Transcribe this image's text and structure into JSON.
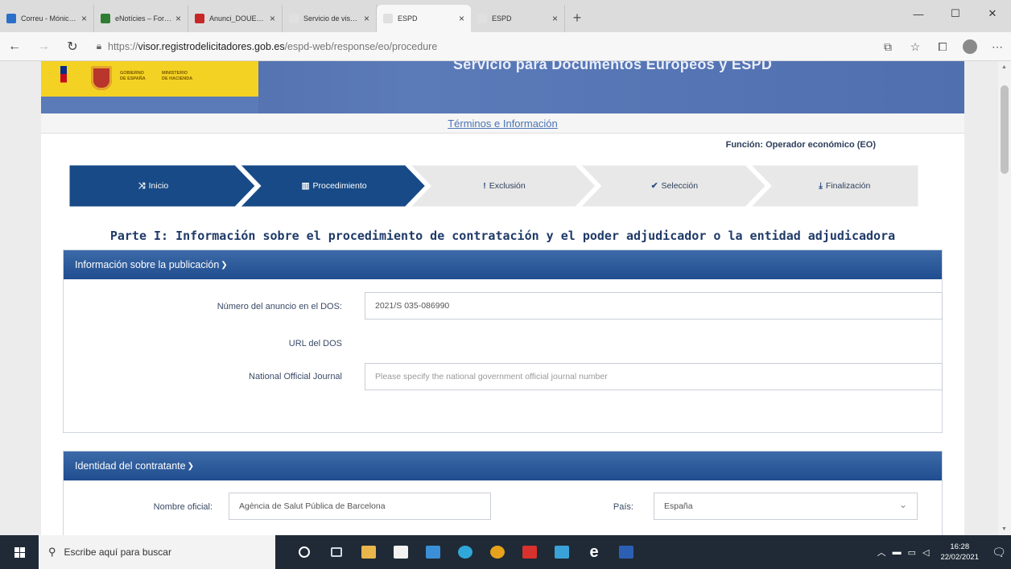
{
  "browser": {
    "tabs": [
      {
        "label": "Correu - Mónica Ro",
        "icon_color": "#2b6fc9"
      },
      {
        "label": "eNotícies – Formes I",
        "icon_color": "#2e7d32"
      },
      {
        "label": "Anunci_DOUE_CON",
        "icon_color": "#c62828"
      },
      {
        "label": "Servicio de visualiza",
        "icon_color": "#e0e0e0"
      },
      {
        "label": "ESPD",
        "icon_color": "#e0e0e0",
        "active": true
      },
      {
        "label": "ESPD",
        "icon_color": "#e0e0e0"
      }
    ],
    "new_tab": "+",
    "window_controls": [
      "—",
      "☐",
      "✕"
    ],
    "url_prefix": "https://",
    "url_domain": "visor.registrodelicitadores.gob.es",
    "url_path": "/espd-web/response/eo/procedure"
  },
  "page": {
    "logo": {
      "line1": "GOBIERNO",
      "line2": "DE ESPAÑA",
      "line3": "MINISTERIO",
      "line4": "DE HACIENDA"
    },
    "banner_title": "Servicio para Documentos Europeos y ESPD",
    "terms_link": "Términos e Información",
    "role": "Función: Operador económico (EO)",
    "steps": [
      {
        "icon": "⤨",
        "label": "Inicio",
        "state": "done"
      },
      {
        "icon": "▥",
        "label": "Procedimiento",
        "state": "current"
      },
      {
        "icon": "!",
        "label": "Exclusión",
        "state": "pending"
      },
      {
        "icon": "✔",
        "label": "Selección",
        "state": "pending"
      },
      {
        "icon": "⤓",
        "label": "Finalización",
        "state": "pending"
      }
    ],
    "parte_title": "Parte I: Información sobre el procedimiento de contratación y el poder adjudicador o la entidad adjudicadora",
    "publication": {
      "header": "Información sobre la publicación",
      "dos_label": "Número del anuncio en el DOS:",
      "dos_value": "2021/S 035-086990",
      "url_label": "URL del DOS",
      "noj_label": "National Official Journal",
      "noj_placeholder": "Please specify the national government official journal number"
    },
    "contracting": {
      "header": "Identidad del contratante",
      "name_label": "Nombre oficial:",
      "name_value": "Agència de Salut Pública de Barcelona",
      "country_label": "País:",
      "country_value": "España"
    }
  },
  "taskbar": {
    "search_placeholder": "Escribe aquí para buscar",
    "time": "16:28",
    "date": "22/02/2021",
    "notification_count": "2"
  },
  "colors": {
    "step_active": "#174a86",
    "step_pending": "#e8e8e8",
    "panel_header": "#1f4d8f",
    "title_blue": "#1f3a68"
  }
}
